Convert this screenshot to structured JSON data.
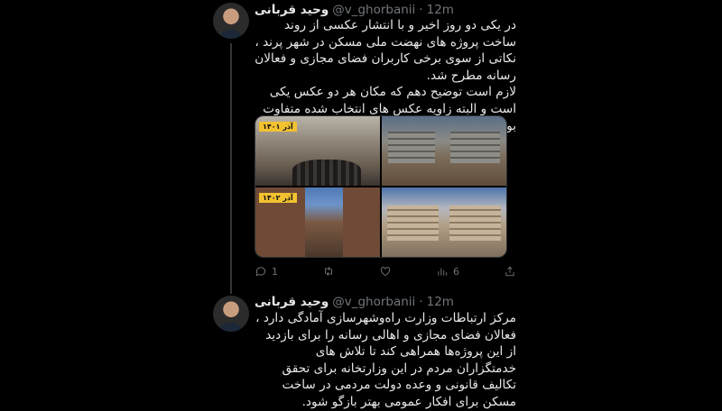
{
  "tweets": [
    {
      "author": "وحید قربانی",
      "handle": "@v_ghorbanii",
      "time": "12m",
      "text": "در یکی دو روز اخیر و با انتشار عکسی از روند ساخت پروژه های نهضت ملی مسکن در شهر پرند ، نکاتی از سوی برخی کاربران فضای مجازی و فعالان رسانه مطرح شد.\nلازم است توضیح دهم که مکان هر دو عکس یکی است و البته زاویه عکس های انتخاب شده متفاوت بود.",
      "media_tags": [
        "آذر ۱۴۰۱",
        "آذر ۱۴۰۲"
      ],
      "reply_count": "1",
      "views_count": "6"
    },
    {
      "author": "وحید قربانی",
      "handle": "@v_ghorbanii",
      "time": "12m",
      "text": "مرکز ارتباطات وزارت راه‌وشهرسازی آمادگی دارد ، فعالان فضای مجازی و اهالی رسانه را برای بازدید از این پروژه‌ها همراهی کند تا تلاش های خدمتگزاران مردم در این وزارتخانه برای تحقق تکالیف قانونی و وعده دولت مردمی در ساخت مسکن برای افکار عمومی بهتر بازگو شود."
    }
  ],
  "icons": {
    "reply": "reply-icon",
    "retweet": "retweet-icon",
    "like": "heart-icon",
    "views": "views-icon",
    "share": "share-icon"
  }
}
